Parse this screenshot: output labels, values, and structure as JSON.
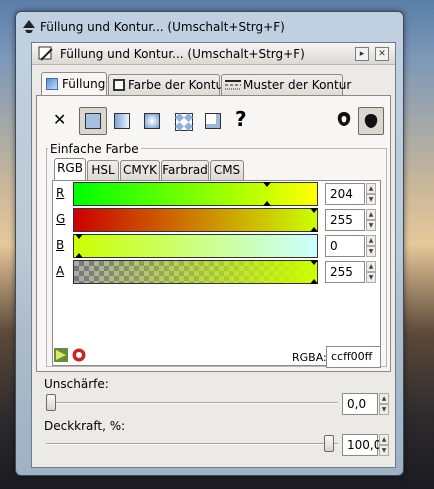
{
  "window": {
    "title": "Füllung und Kontur... (Umschalt+Strg+F)"
  },
  "dock": {
    "title": "Füllung und Kontur... (Umschalt+Strg+F)"
  },
  "tabs": [
    {
      "label": "Füllung"
    },
    {
      "label": "Farbe der Kontur"
    },
    {
      "label": "Muster der Kontur"
    }
  ],
  "fill_modes": {
    "unset_symbol": "✕",
    "unknown_symbol": "?"
  },
  "color_frame": {
    "label": "Einfache Farbe"
  },
  "color_tabs": [
    {
      "label": "RGB"
    },
    {
      "label": "HSL"
    },
    {
      "label": "CMYK"
    },
    {
      "label": "Farbrad"
    },
    {
      "label": "CMS"
    }
  ],
  "channels": [
    {
      "label": "R",
      "value": "204",
      "level": 0.8
    },
    {
      "label": "G",
      "value": "255",
      "level": 1.0
    },
    {
      "label": "B",
      "value": "0",
      "level": 0.0
    },
    {
      "label": "A",
      "value": "255",
      "level": 1.0
    }
  ],
  "rgba": {
    "label": "RGBA:",
    "value": "ccff00ff"
  },
  "blur": {
    "label": "Unschärfe:",
    "value": "0,0",
    "level": 0.0
  },
  "opacity": {
    "label": "Deckkraft, %:",
    "value": "100,0",
    "level": 1.0
  },
  "colors": {
    "current": "#ccff00"
  }
}
